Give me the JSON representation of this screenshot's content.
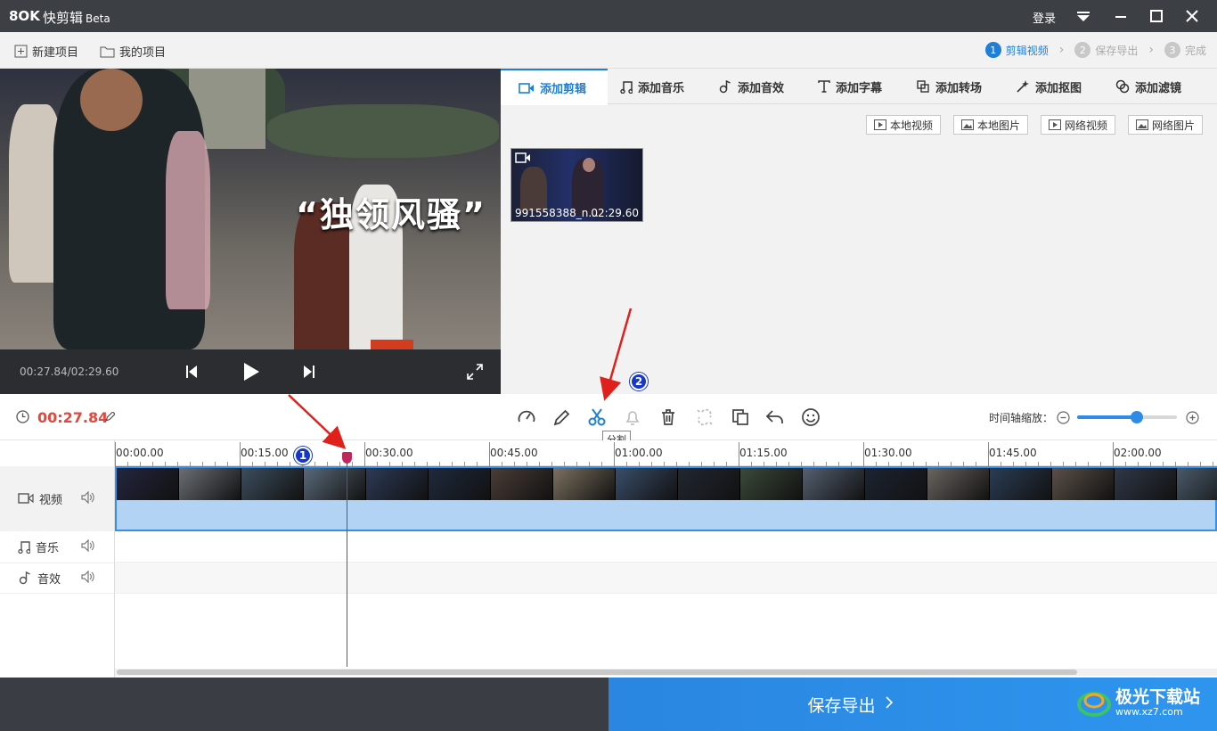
{
  "app": {
    "logo": "8OK",
    "title": "快剪辑",
    "beta": "Beta",
    "login": "登录"
  },
  "menu": {
    "new_project": "新建项目",
    "my_projects": "我的项目"
  },
  "steps": [
    {
      "num": "1",
      "label": "剪辑视频",
      "active": true
    },
    {
      "num": "2",
      "label": "保存导出",
      "active": false
    },
    {
      "num": "3",
      "label": "完成",
      "active": false
    }
  ],
  "preview": {
    "caption": "“独领风骚”",
    "timecode": "00:27.84/02:29.60"
  },
  "tabs": [
    {
      "label": "添加剪辑",
      "icon": "video-camera-icon"
    },
    {
      "label": "添加音乐",
      "icon": "music-note-icon"
    },
    {
      "label": "添加音效",
      "icon": "sound-effect-icon"
    },
    {
      "label": "添加字幕",
      "icon": "text-icon"
    },
    {
      "label": "添加转场",
      "icon": "transition-icon"
    },
    {
      "label": "添加抠图",
      "icon": "magic-wand-icon"
    },
    {
      "label": "添加滤镜",
      "icon": "filter-icon"
    }
  ],
  "sources": {
    "local_video": "本地视频",
    "local_image": "本地图片",
    "web_video": "网络视频",
    "web_image": "网络图片"
  },
  "clip": {
    "name": "991558388_n...",
    "duration": "02:29.60"
  },
  "toolbar": {
    "current_time": "00:27.84",
    "tooltip": "分割",
    "zoom_label": "时间轴缩放：",
    "zoom_level": 0.6
  },
  "ruler": [
    "00:00.00",
    "00:15.00",
    "00:30.00",
    "00:45.00",
    "01:00.00",
    "01:15.00",
    "01:30.00",
    "01:45.00",
    "02:00.00"
  ],
  "tracks": {
    "video": "视频",
    "music": "音乐",
    "sfx": "音效"
  },
  "export": {
    "label": "保存导出"
  },
  "annotations": {
    "badge1": "1",
    "badge2": "2"
  },
  "watermark": {
    "text": "极光下载站",
    "url": "www.xz7.com"
  },
  "colors": {
    "accent": "#1e7fd6",
    "time_red": "#e3483e",
    "playhead": "#c0275a",
    "export_blue": "#2a86e0"
  }
}
